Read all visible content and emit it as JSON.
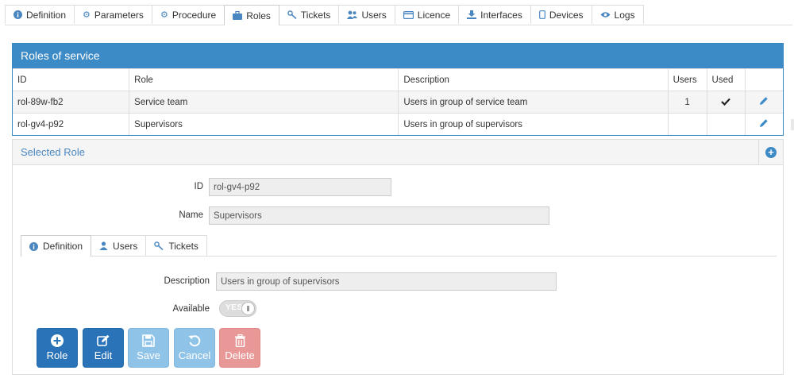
{
  "tabs": [
    {
      "label": "Definition",
      "icon": "info-icon"
    },
    {
      "label": "Parameters",
      "icon": "gear-icon"
    },
    {
      "label": "Procedure",
      "icon": "gears-icon"
    },
    {
      "label": "Roles",
      "icon": "briefcase-icon",
      "active": true
    },
    {
      "label": "Tickets",
      "icon": "key-icon"
    },
    {
      "label": "Users",
      "icon": "users-icon"
    },
    {
      "label": "Licence",
      "icon": "card-icon"
    },
    {
      "label": "Interfaces",
      "icon": "download-icon"
    },
    {
      "label": "Devices",
      "icon": "mobile-icon"
    },
    {
      "label": "Logs",
      "icon": "eye-icon"
    }
  ],
  "roles": {
    "title": "Roles of service",
    "columns": {
      "id": "ID",
      "role": "Role",
      "description": "Description",
      "users": "Users",
      "used": "Used"
    },
    "rows": [
      {
        "id": "rol-89w-fb2",
        "role": "Service team",
        "description": "Users in group of service team",
        "users": "1",
        "used": true
      },
      {
        "id": "rol-gv4-p92",
        "role": "Supervisors",
        "description": "Users in group of supervisors",
        "users": "",
        "used": false
      }
    ]
  },
  "selected": {
    "title": "Selected Role",
    "id_label": "ID",
    "id_value": "rol-gv4-p92",
    "name_label": "Name",
    "name_value": "Supervisors",
    "tabs": [
      {
        "label": "Definition",
        "icon": "info-icon",
        "active": true
      },
      {
        "label": "Users",
        "icon": "user-icon"
      },
      {
        "label": "Tickets",
        "icon": "key-icon"
      }
    ],
    "description_label": "Description",
    "description_value": "Users in group of supervisors",
    "available_label": "Available",
    "available_toggle": "YES",
    "buttons": {
      "role": "Role",
      "edit": "Edit",
      "save": "Save",
      "cancel": "Cancel",
      "delete": "Delete"
    }
  },
  "colors": {
    "accent": "#3d8bc6",
    "primary_button": "#2a73b8",
    "disabled_button": "#8fc3e8",
    "delete_button": "#e89896"
  }
}
